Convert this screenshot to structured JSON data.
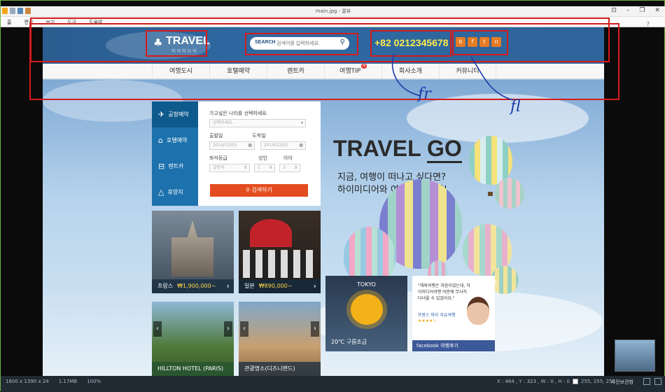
{
  "viewer": {
    "title": "main.jpg - 꿀뷰",
    "menu": [
      "홈",
      "편집",
      "보기",
      "도구",
      "도움말"
    ],
    "status": {
      "dims": "1600 x 1390 x 24",
      "size": "1.17MB",
      "zoom": "100%",
      "coords": "X : 464 , Y : 323 , W : 0 , H : 0",
      "rgb": "255, 255, 255",
      "view_label": "사진보관함"
    }
  },
  "site": {
    "logo": {
      "title": "TRAVEL",
      "subtitle": "하이미디어"
    },
    "search": {
      "label": "SEARCH",
      "placeholder": "검색어를 입력하세요."
    },
    "phone": "+82 0212345678",
    "social": [
      "b",
      "f",
      "t",
      "n"
    ],
    "nav": [
      "여행도시",
      "호텔예약",
      "렌트카",
      "여행TIP",
      "회사소개",
      "커뮤니티"
    ],
    "nav_badge": "N",
    "booking": {
      "tabs": [
        "공항예약",
        "호텔예약",
        "렌트카",
        "휴양지"
      ],
      "country_label": "가고싶은 나라를 선택하세요.",
      "country_select": "선택하세요.",
      "depart_label": "출발일",
      "arrive_label": "도착일",
      "depart_value": "2014/12/01",
      "arrive_value": "2014/12/01",
      "seat_label": "좌석등급",
      "adult_label": "성인",
      "child_label": "아이",
      "seat_value": "일반석",
      "adult_value": "1",
      "child_value": "3",
      "search_button": "검색하기"
    },
    "tiles": [
      {
        "name": "프랑스",
        "price": "₩1,900,000~"
      },
      {
        "name": "일본",
        "price": "₩890,000~"
      },
      {
        "name": "HILLTON HOTEL (PARIS)",
        "price": ""
      },
      {
        "name": "관광명소(디즈니랜드)",
        "price": ""
      }
    ],
    "headline_a": "TRAVEL ",
    "headline_b": "GO",
    "subline_1": "지금, 여행이 떠나고 싶다면?",
    "subline_2": "하이미디어와 여행을 떠나자!",
    "weather": {
      "city": "TOKYO",
      "temp": "20℃ 구름조금"
    },
    "review": {
      "quote": "\"해외여행은 처음이었는데, 하이미디어여행 덕분에 무사히 다녀올 수 있었어요.\"",
      "who": "프랑스 파리 자유여행",
      "stars": "★★★★☆",
      "facebook": "facebook 여행후기"
    }
  },
  "annotations": {
    "left": "fr",
    "right": "fl"
  },
  "colors": {
    "accent": "#e34c1e",
    "header": "#2f6aa3",
    "phone": "#ffe94a",
    "box": "#d61a1a",
    "ink": "#1a3aa8"
  }
}
